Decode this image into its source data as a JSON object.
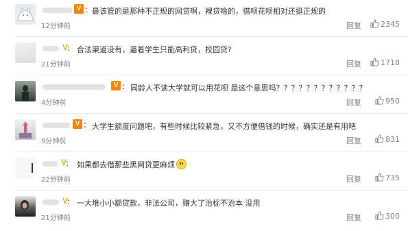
{
  "comments": [
    {
      "avatar": "avatar-cat-icon",
      "verified": "V",
      "colon": ":",
      "text": "最该管的是那种不正规的网贷啊，裸贷啥的，借呗花呗相对还挺正规的",
      "time": "12分钟前",
      "reply": "回复",
      "likes": "2345"
    },
    {
      "avatar": "avatar-default-icon",
      "verified": "V",
      "colon": ":",
      "text": "合法渠道没有，逼着学生只能高利贷，校园贷?",
      "time": "21分钟前",
      "reply": "回复",
      "likes": "1718"
    },
    {
      "avatar": "avatar-photo-icon",
      "verified": "V",
      "colon": ":",
      "text": "同龄人不读大学就可以用花呗 是这个意思吗？？？？？？？？？？？？",
      "time": "4分钟前",
      "reply": "回复",
      "likes": "950"
    },
    {
      "avatar": "avatar-photo-icon",
      "verified": "V",
      "colon": ":",
      "text": "大学生额度问题吧，有些时候比较紧急，又不方便借钱的时候，确实还是有用吧",
      "time": "9分钟前",
      "reply": "回复",
      "likes": "831"
    },
    {
      "avatar": "avatar-default-icon",
      "verified": "V",
      "colon": ":",
      "text": "如果都去借那些黑网贷更麻烦",
      "time": "22分钟前",
      "reply": "回复",
      "likes": "735"
    },
    {
      "avatar": "avatar-photo-icon",
      "verified": "V",
      "colon": ":",
      "text": "一大堆小小额贷款，非法公司，赚大了治标不治本 没用",
      "time": "21分钟前",
      "reply": "回复",
      "likes": "300"
    }
  ],
  "icons": {
    "like": "thumbs-up-icon",
    "emoji": "smile-emoji-icon"
  },
  "colors": {
    "verified_orange": "#ff8200",
    "verified_yellow": "#f5a623",
    "meta_gray": "#808080"
  }
}
